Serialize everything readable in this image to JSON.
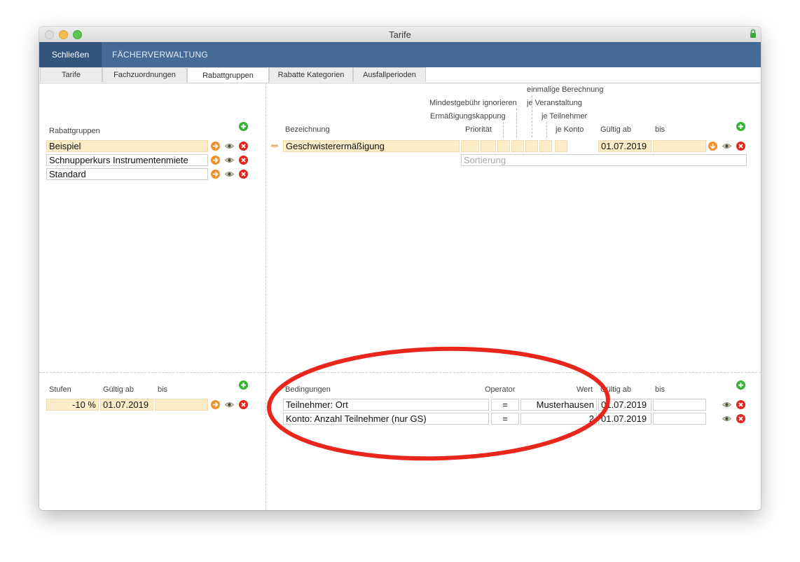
{
  "window": {
    "title": "Tarife"
  },
  "toolbar": {
    "close_label": "Schließen",
    "module_label": "FÄCHERVERWALTUNG"
  },
  "tabs": [
    {
      "label": "Tarife",
      "active": false
    },
    {
      "label": "Fachzuordnungen",
      "active": false
    },
    {
      "label": "Rabattgruppen",
      "active": true
    },
    {
      "label": "Rabatte Kategorien",
      "active": false
    },
    {
      "label": "Ausfallperioden",
      "active": false
    }
  ],
  "rabattgruppen": {
    "header": "Rabattgruppen",
    "items": [
      {
        "label": "Beispiel",
        "selected": true
      },
      {
        "label": "Schnupperkurs Instrumentenmiete",
        "selected": false
      },
      {
        "label": "Standard",
        "selected": false
      }
    ]
  },
  "rabatte": {
    "headers": {
      "bezeichnung": "Bezeichnung",
      "prioritaet": "Priorität",
      "ermaessigungskappung": "Ermäßigungskappung",
      "mindestgebuehr": "Mindestgebühr ignorieren",
      "einmalige": "einmalige Berechnung",
      "je_veranstaltung": "je Veranstaltung",
      "je_teilnehmer": "je Teilnehmer",
      "je_konto": "je Konto",
      "gueltig_ab": "Gültig ab",
      "bis": "bis"
    },
    "rows": [
      {
        "bezeichnung": "Geschwisterermäßigung",
        "gueltig_ab": "01.07.2019",
        "bis": ""
      }
    ],
    "sortierung_placeholder": "Sortierung"
  },
  "stufen": {
    "headers": {
      "stufen": "Stufen",
      "gueltig_ab": "Gültig ab",
      "bis": "bis"
    },
    "rows": [
      {
        "wert": "-10 %",
        "gueltig_ab": "01.07.2019",
        "bis": ""
      }
    ]
  },
  "bedingungen": {
    "headers": {
      "bedingungen": "Bedingungen",
      "operator": "Operator",
      "wert": "Wert",
      "gueltig_ab": "Gültig ab",
      "bis": "bis"
    },
    "rows": [
      {
        "bedingung": "Teilnehmer: Ort",
        "operator": "=",
        "wert": "Musterhausen",
        "gueltig_ab": "01.07.2019",
        "bis": ""
      },
      {
        "bedingung": "Konto: Anzahl Teilnehmer (nur GS)",
        "operator": "=",
        "wert": "2",
        "gueltig_ab": "01.07.2019",
        "bis": ""
      }
    ]
  },
  "colors": {
    "toolbar": "#466a97",
    "toolbar_active": "#33547c",
    "field_yellow": "#fdecc8",
    "add_green": "#2fb52f",
    "delete_red": "#e0261e",
    "nav_orange": "#f0922a",
    "annotation_red": "#e8261c"
  }
}
